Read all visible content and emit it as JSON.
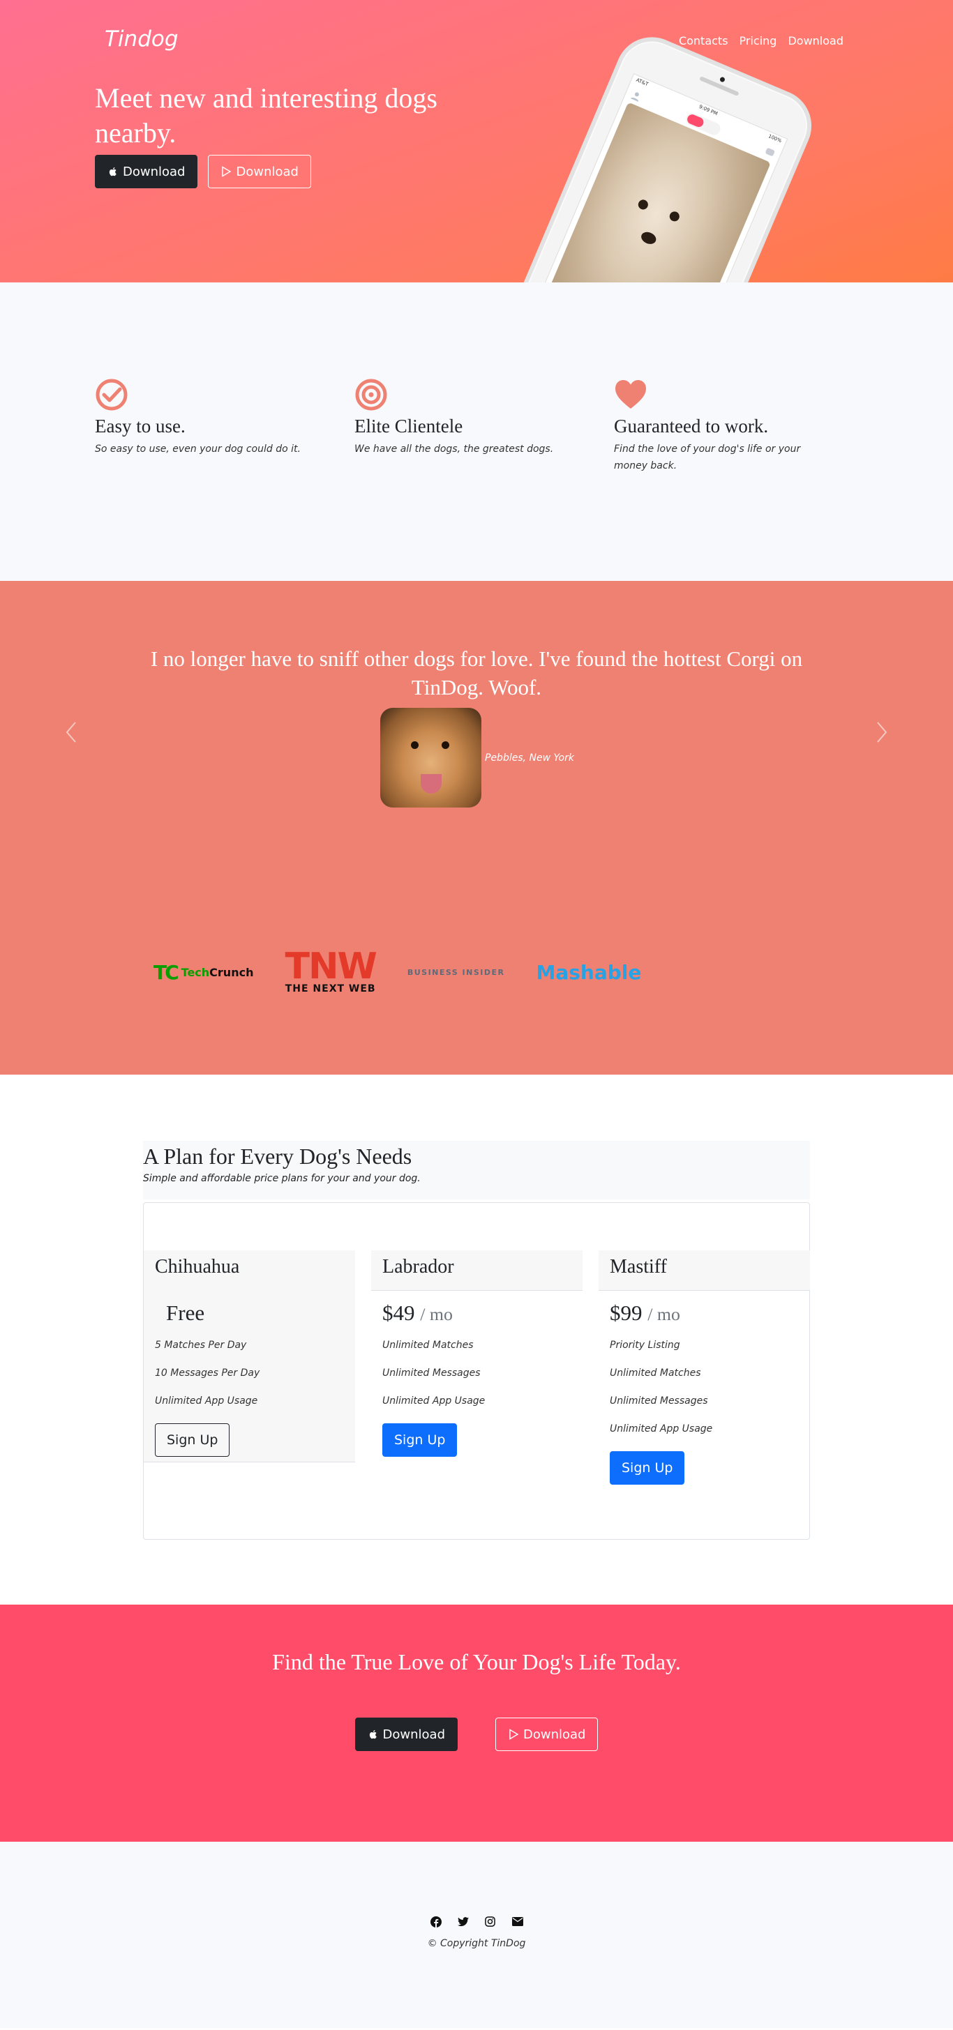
{
  "nav": {
    "brand": "Tindog",
    "links": [
      "Contacts",
      "Pricing",
      "Download"
    ]
  },
  "hero": {
    "headline": "Meet new and interesting dogs nearby.",
    "apple_button": "Download",
    "play_button": "Download",
    "phone": {
      "time": "9:09 PM",
      "carrier": "AT&T",
      "battery": "100%"
    }
  },
  "features": [
    {
      "icon": "check-circle-icon",
      "title": "Easy to use.",
      "text": "So easy to use, even your dog could do it."
    },
    {
      "icon": "bullseye-icon",
      "title": "Elite Clientele",
      "text": "We have all the dogs, the greatest dogs."
    },
    {
      "icon": "heart-icon",
      "title": "Guaranteed to work.",
      "text": "Find the love of your dog's life or your money back."
    }
  ],
  "testimonial": {
    "quote": "I no longer have to sniff other dogs for love. I've found the hottest Corgi on TinDog. Woof.",
    "author": "Pebbles, New York"
  },
  "press": {
    "techcrunch_mark": "TC",
    "techcrunch_name_a": "Tech",
    "techcrunch_name_b": "Crunch",
    "tnw_big": "TNW",
    "tnw_small": "THE NEXT WEB",
    "business_insider": "BUSINESS INSIDER",
    "mashable": "Mashable"
  },
  "pricing": {
    "title": "A Plan for Every Dog's Needs",
    "subtitle": "Simple and affordable price plans for your and your dog.",
    "plans": [
      {
        "name": "Chihuahua",
        "price": "Free",
        "features": [
          "5 Matches Per Day",
          "10 Messages Per Day",
          "Unlimited App Usage"
        ],
        "button": "Sign Up"
      },
      {
        "name": "Labrador",
        "price": "$49",
        "unit": "/ mo",
        "features": [
          "Unlimited Matches",
          "Unlimited Messages",
          "Unlimited App Usage"
        ],
        "button": "Sign Up"
      },
      {
        "name": "Mastiff",
        "price": "$99",
        "unit": "/ mo",
        "features": [
          "Priority Listing",
          "Unlimited Matches",
          "Unlimited Messages",
          "Unlimited App Usage"
        ],
        "button": "Sign Up"
      }
    ]
  },
  "cta": {
    "title": "Find the True Love of Your Dog's Life Today.",
    "apple_button": "Download",
    "play_button": "Download"
  },
  "footer": {
    "icons": [
      "facebook-icon",
      "twitter-icon",
      "instagram-icon",
      "envelope-icon"
    ],
    "copyright": "© Copyright TinDog"
  },
  "colors": {
    "hero_gradient_start": "#ff6f91",
    "hero_gradient_end": "#ff7b45",
    "testimonial_bg": "#ef8172",
    "cta_bg": "#ff4c68",
    "primary": "#0d6efd",
    "feature_icon": "#ef8172"
  }
}
